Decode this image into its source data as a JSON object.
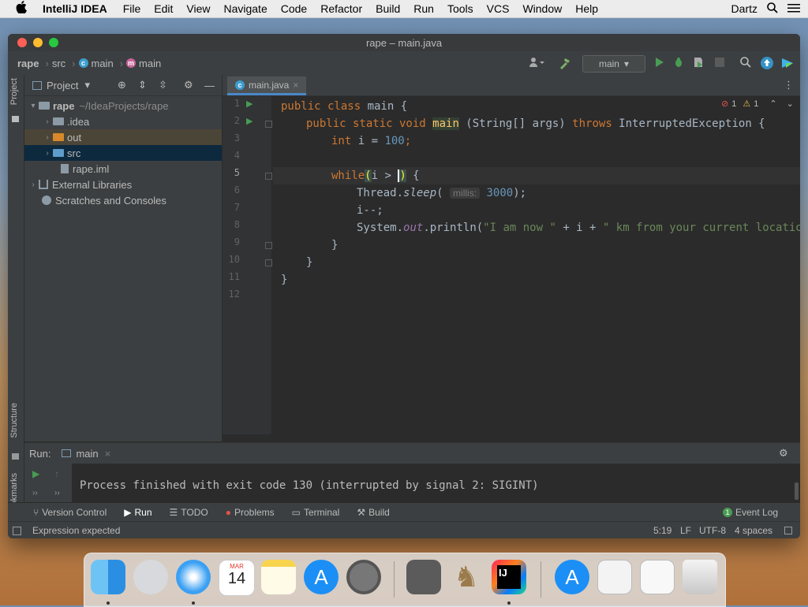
{
  "menubar": {
    "apple": "",
    "app": "IntelliJ IDEA",
    "items": [
      "File",
      "Edit",
      "View",
      "Navigate",
      "Code",
      "Refactor",
      "Build",
      "Run",
      "Tools",
      "VCS",
      "Window",
      "Help"
    ],
    "user": "Dartz"
  },
  "window": {
    "title": "rape – main.java",
    "breadcrumb": {
      "project": "rape",
      "src": "src",
      "class": "main",
      "method": "main"
    },
    "run_config": "main"
  },
  "project_panel": {
    "title": "Project",
    "tree": {
      "root_name": "rape",
      "root_path": "~/IdeaProjects/rape",
      "idea": ".idea",
      "out": "out",
      "src": "src",
      "iml": "rape.iml",
      "ext_libs": "External Libraries",
      "scratches": "Scratches and Consoles"
    }
  },
  "left_tabs": {
    "project": "Project",
    "structure": "Structure",
    "bookmarks": "Bookmarks"
  },
  "editor": {
    "tab": "main.java",
    "errors": "1",
    "warnings": "1",
    "line_numbers": [
      "1",
      "2",
      "3",
      "4",
      "5",
      "6",
      "7",
      "8",
      "9",
      "10",
      "11",
      "12"
    ],
    "code": {
      "l1_kw": "public class ",
      "l1_rest": "main {",
      "l2_kw1": "public static void ",
      "l2_main": "main",
      "l2_mid": " (String[] args) ",
      "l2_kw2": "throws",
      "l2_rest": " InterruptedException {",
      "l3_kw": "int",
      "l3_mid": " i = ",
      "l3_num": "100",
      "l3_end": ";",
      "l5_kw": "while",
      "l5_paren": "(",
      "l5_mid": "i > ",
      "l5_caret": ")",
      "l5_end": " {",
      "l6_pre": "Thread.",
      "l6_sleep": "sleep",
      "l6_open": "( ",
      "l6_hint": "millis:",
      "l6_num": " 3000",
      "l6_end": ");",
      "l7": "i--;",
      "l8_pre": "System.",
      "l8_out": "out",
      "l8_mid": ".println(",
      "l8_s1": "\"I am now \"",
      "l8_mid2": " + i + ",
      "l8_s2": "\" km from your current location\"",
      "l8_end": ");",
      "l9": "}",
      "l10": "}",
      "l11": "}"
    }
  },
  "run_panel": {
    "label": "Run:",
    "tab": "main",
    "output": "Process finished with exit code 130 (interrupted by signal 2: SIGINT)"
  },
  "bottom_tools": [
    "Version Control",
    "Run",
    "TODO",
    "Problems",
    "Terminal",
    "Build"
  ],
  "event_log": "Event Log",
  "event_count": "1",
  "status": {
    "message": "Expression expected",
    "position": "5:19",
    "line_sep": "LF",
    "encoding": "UTF-8",
    "indent": "4 spaces"
  },
  "dock": {
    "calendar_month": "MAR",
    "calendar_day": "14",
    "intellij_label": "IJ"
  },
  "colors": {
    "keyword": "#cc7832",
    "number": "#6897bb",
    "string": "#6a8759",
    "run_green": "#499c54",
    "accent_blue": "#4a88c7"
  }
}
